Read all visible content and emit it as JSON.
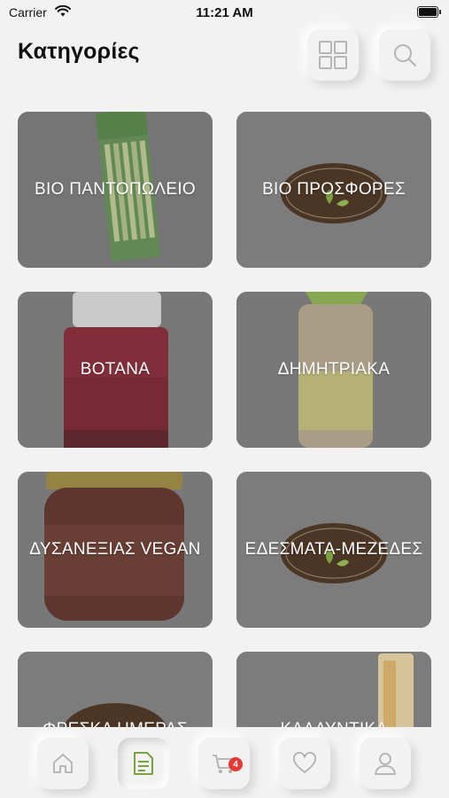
{
  "status_bar": {
    "carrier": "Carrier",
    "time": "11:21 AM"
  },
  "header": {
    "title": "Κατηγορίες",
    "grid_icon": "grid-view-icon",
    "search_icon": "search-icon"
  },
  "categories": [
    {
      "label": "ΒΙΟ ΠΑΝΤΟΠΩΛΕΙΟ"
    },
    {
      "label": "ΒΙΟ ΠΡΟΣΦΟΡΕΣ"
    },
    {
      "label": "ΒΟΤΑΝΑ"
    },
    {
      "label": "ΔΗΜΗΤΡΙΑΚΑ"
    },
    {
      "label": "ΔΥΣΑΝΕΞΙΑΣ VEGAN"
    },
    {
      "label": "ΕΔΕΣΜΑΤΑ-ΜΕΖΕΔΕΣ"
    },
    {
      "label": "ΦΡΕΣΚΑ ΗΜΕΡΑΣ"
    },
    {
      "label": "ΚΑΛΛΥΝΤΙΚΑ"
    }
  ],
  "tabbar": {
    "tabs": [
      {
        "icon": "home-icon"
      },
      {
        "icon": "categories-list-icon",
        "active": true
      },
      {
        "icon": "cart-icon",
        "badge": "4"
      },
      {
        "icon": "heart-icon"
      },
      {
        "icon": "user-icon"
      }
    ]
  },
  "colors": {
    "background": "#f2f2f2",
    "card_overlay": "#7a7a7a",
    "accent_green": "#6a9a2a",
    "badge_red": "#e53935"
  }
}
